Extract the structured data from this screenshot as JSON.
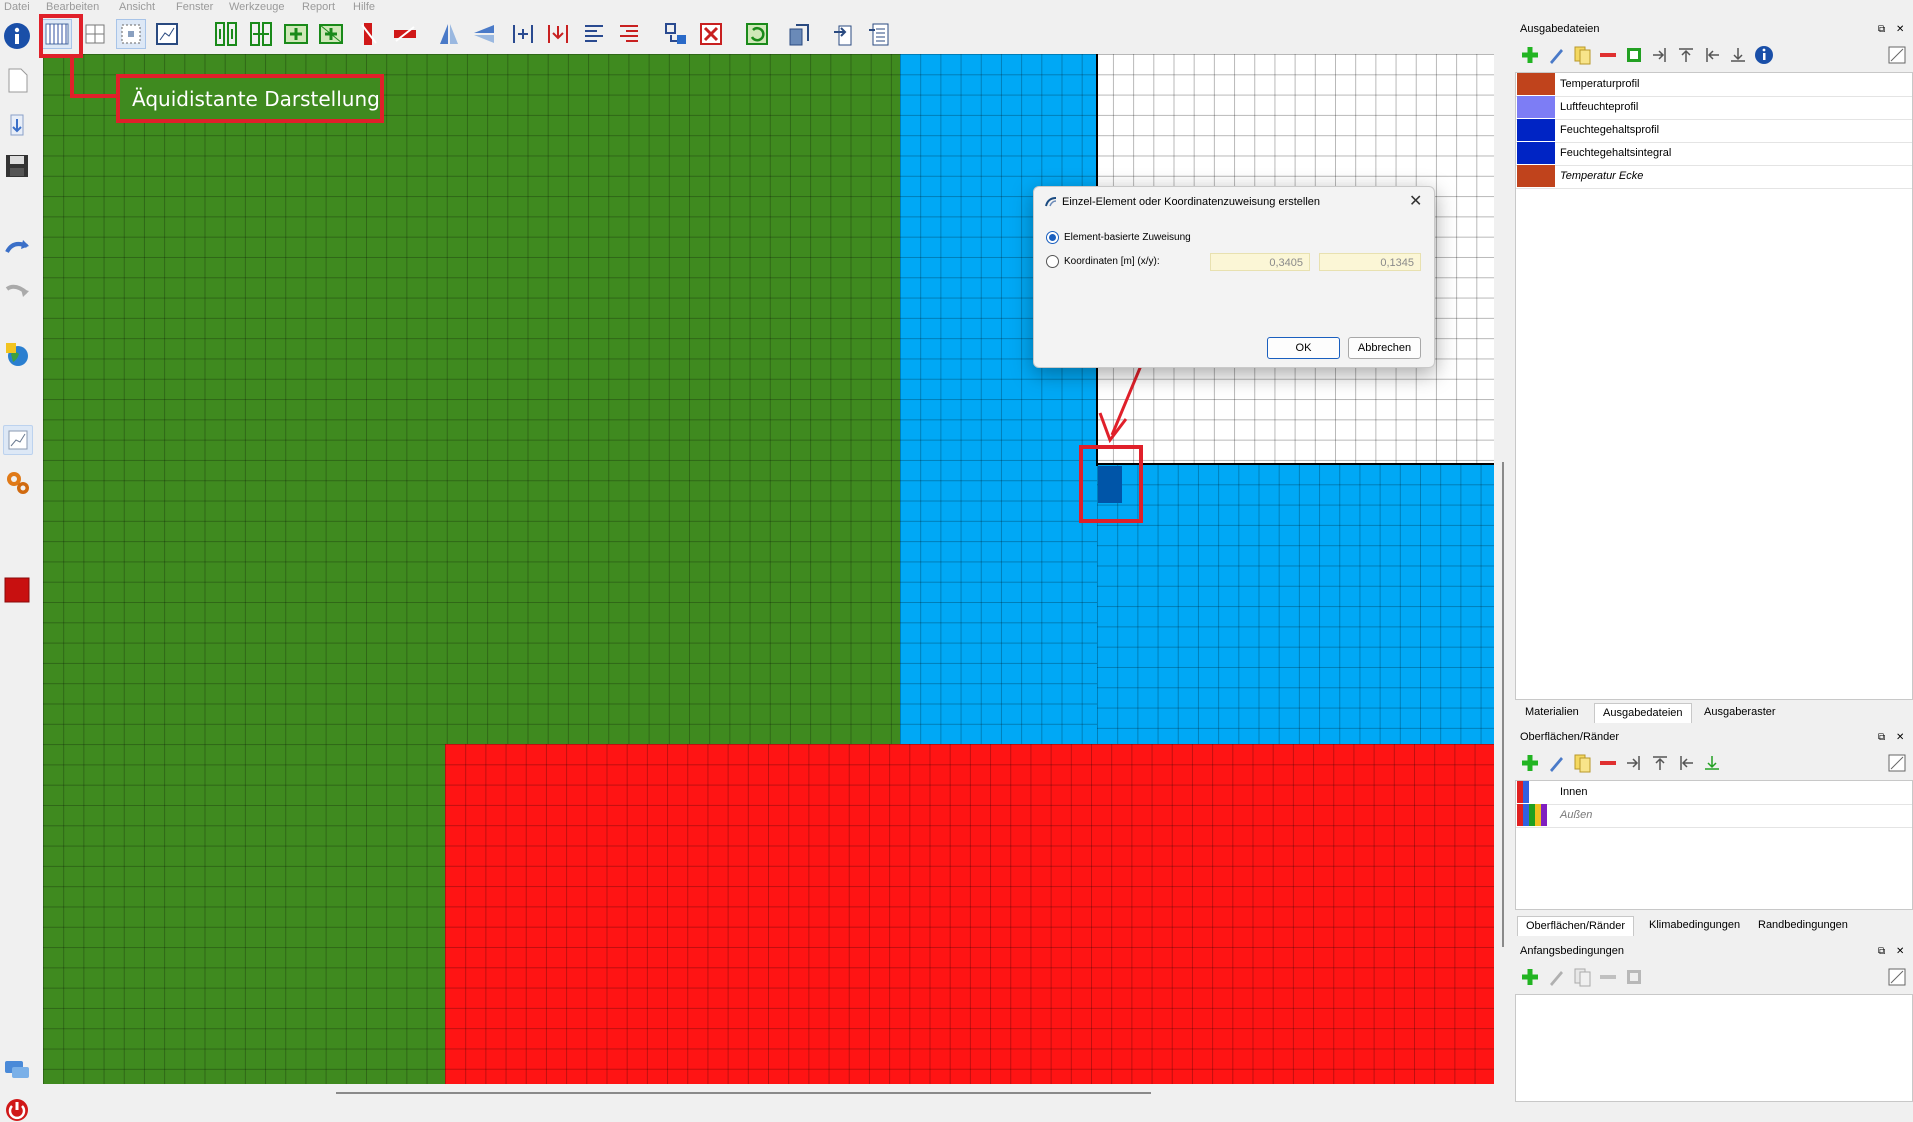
{
  "menu": [
    "Datei",
    "Bearbeiten",
    "Ansicht",
    "Fenster",
    "Werkzeuge",
    "Report",
    "Hilfe"
  ],
  "annotation": {
    "label": "Äquidistante Darstellung",
    "color": "#e0202a"
  },
  "toolbar_icons": [
    "equidistant-view-icon",
    "grid-view-icon",
    "select-area-icon",
    "chart-view-icon",
    "split-columns-icon",
    "merge-columns-icon",
    "insert-column-left-icon",
    "insert-column-right-icon",
    "delete-column-icon",
    "delete-row-icon",
    "mirror-horizontal-icon",
    "mirror-vertical-icon",
    "insert-line-icon",
    "delete-line-icon",
    "align-left-icon",
    "align-right-icon",
    "assign-element-icon",
    "remove-assignment-icon",
    "refresh-icon",
    "export-icon",
    "import-icon",
    "report-icon"
  ],
  "left_icons": [
    "info-icon",
    "new-file-icon",
    "open-file-icon",
    "save-icon",
    "undo-icon",
    "redo-icon",
    "globe-icon",
    "chart-icon",
    "settings-gears-icon",
    "red-square-icon",
    "chat-icon",
    "power-icon"
  ],
  "colors": {
    "green": "#3f8a1f",
    "blue": "#00a8f5",
    "red": "#ff1414",
    "dark_blue": "#0055a8"
  },
  "dialog": {
    "title": "Einzel-Element oder Koordinatenzuweisung erstellen",
    "option1": "Element-basierte Zuweisung",
    "option2": "Koordinaten [m] (x/y):",
    "x_value": "0,3405",
    "y_value": "0,1345",
    "ok": "OK",
    "cancel": "Abbrechen"
  },
  "panels": {
    "output_files": {
      "title": "Ausgabedateien",
      "items": [
        {
          "label": "Temperaturprofil",
          "color": "#c0431c"
        },
        {
          "label": "Luftfeuchteprofil",
          "color": "#7d7df5"
        },
        {
          "label": "Feuchtegehaltsprofil",
          "color": "#0024c4"
        },
        {
          "label": "Feuchtegehaltsintegral",
          "color": "#0024c4"
        },
        {
          "label": "Temperatur Ecke",
          "color": "#c0431c"
        }
      ],
      "tabs": [
        "Materialien",
        "Ausgabedateien",
        "Ausgaberaster"
      ]
    },
    "surfaces": {
      "title": "Oberflächen/Ränder",
      "items": [
        {
          "label": "Innen"
        },
        {
          "label": "Außen"
        }
      ],
      "tabs": [
        "Oberflächen/Ränder",
        "Klimabedingungen",
        "Randbedingungen"
      ]
    },
    "initial": {
      "title": "Anfangsbedingungen"
    }
  }
}
